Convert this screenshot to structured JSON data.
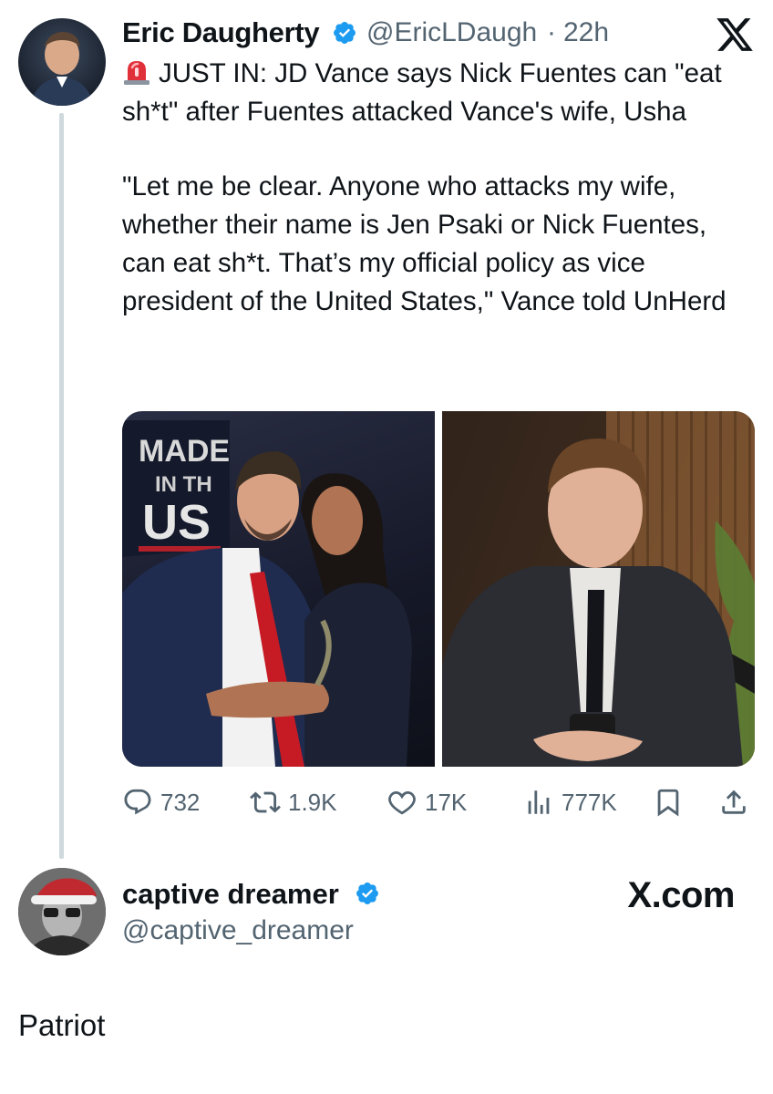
{
  "tweet": {
    "author_name": "Eric Daugherty",
    "author_handle": "@EricLDaugh",
    "separator": "·",
    "time": "22h",
    "text_para1": "JUST IN: JD Vance says Nick Fuentes can \"eat sh*t\" after Fuentes attacked Vance's wife, Usha",
    "text_para2": "\"Let me be clear. Anyone who attacks my wife, whether their name is Jen Psaki or Nick Fuentes, can eat sh*t. That’s my official policy as vice president of the United States,\" Vance told UnHerd",
    "icons": {
      "siren": "siren-emoji-icon",
      "verified": "verified-badge-icon",
      "logo": "x-logo-icon"
    },
    "media_sign_text": [
      "MADE",
      "IN TH",
      "US"
    ],
    "stats": {
      "replies": "732",
      "reposts": "1.9K",
      "likes": "17K",
      "views": "777K"
    }
  },
  "reply_user": {
    "name": "captive dreamer",
    "handle": "@captive_dreamer",
    "site_label": "X.com",
    "text": "Patriot"
  },
  "colors": {
    "text": "#0f1419",
    "secondary": "#536471",
    "verified": "#1d9bf0",
    "thread_line": "#cfd9de"
  }
}
